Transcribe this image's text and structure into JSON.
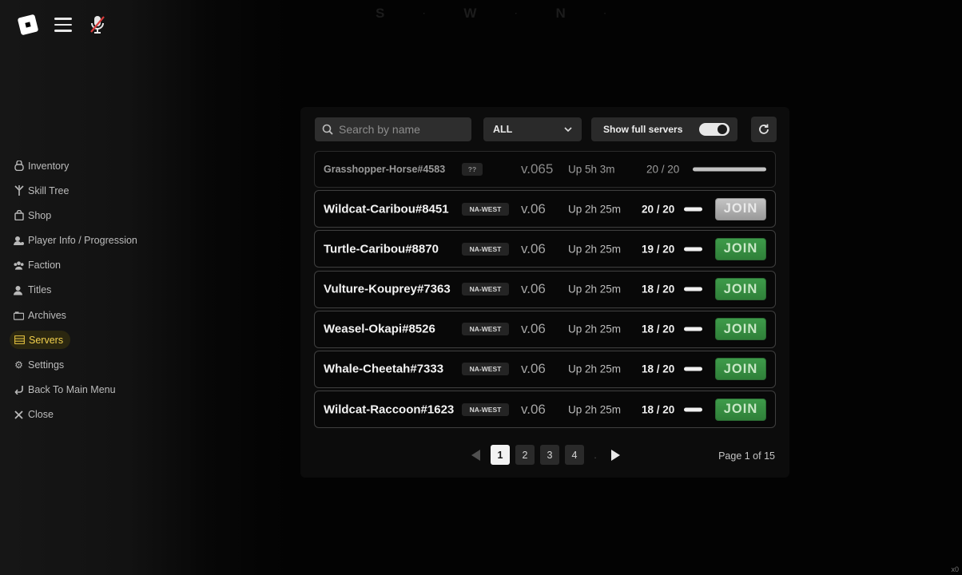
{
  "topbar": {
    "menu_icon": "hamburger-icon",
    "mic_icon": "mic-muted-icon",
    "logo": "roblox-logo"
  },
  "compass": [
    "S",
    "W",
    "N"
  ],
  "sidebar": {
    "items": [
      {
        "label": "Inventory",
        "icon": "bag-icon"
      },
      {
        "label": "Skill Tree",
        "icon": "skill-tree-icon"
      },
      {
        "label": "Shop",
        "icon": "shop-icon"
      },
      {
        "label": "Player Info / Progression",
        "icon": "player-icon"
      },
      {
        "label": "Faction",
        "icon": "group-icon"
      },
      {
        "label": "Titles",
        "icon": "user-icon"
      },
      {
        "label": "Archives",
        "icon": "archive-icon"
      },
      {
        "label": "Servers",
        "icon": "servers-icon",
        "active": true
      },
      {
        "label": "Settings",
        "icon": "gear-icon"
      },
      {
        "label": "Back To Main Menu",
        "icon": "back-arrow-icon"
      },
      {
        "label": "Close",
        "icon": "close-icon"
      }
    ]
  },
  "filters": {
    "search_placeholder": "Search by name",
    "region_select": "ALL",
    "show_full_label": "Show full servers",
    "show_full_on": true
  },
  "servers": [
    {
      "name": "Grasshopper-Horse#4583",
      "region": "??",
      "version": "v.065",
      "uptime": "Up 5h 3m",
      "players": "20 / 20",
      "fill": 1.0,
      "join": ""
    },
    {
      "name": "Wildcat-Caribou#8451",
      "region": "NA-WEST",
      "version": "v.06",
      "uptime": "Up 2h 25m",
      "players": "20 / 20",
      "fill": 1.0,
      "join": "JOIN",
      "full": true
    },
    {
      "name": "Turtle-Caribou#8870",
      "region": "NA-WEST",
      "version": "v.06",
      "uptime": "Up 2h 25m",
      "players": "19 / 20",
      "fill": 0.95,
      "join": "JOIN"
    },
    {
      "name": "Vulture-Kouprey#7363",
      "region": "NA-WEST",
      "version": "v.06",
      "uptime": "Up 2h 25m",
      "players": "18 / 20",
      "fill": 0.9,
      "join": "JOIN"
    },
    {
      "name": "Weasel-Okapi#8526",
      "region": "NA-WEST",
      "version": "v.06",
      "uptime": "Up 2h 25m",
      "players": "18 / 20",
      "fill": 0.9,
      "join": "JOIN"
    },
    {
      "name": "Whale-Cheetah#7333",
      "region": "NA-WEST",
      "version": "v.06",
      "uptime": "Up 2h 25m",
      "players": "18 / 20",
      "fill": 0.9,
      "join": "JOIN"
    },
    {
      "name": "Wildcat-Raccoon#1623",
      "region": "NA-WEST",
      "version": "v.06",
      "uptime": "Up 2h 25m",
      "players": "18 / 20",
      "fill": 0.9,
      "join": "JOIN"
    }
  ],
  "pagination": {
    "pages": [
      "1",
      "2",
      "3",
      "4"
    ],
    "current": "1",
    "info": "Page 1 of 15"
  },
  "corner_text": "x0",
  "colors": {
    "accent": "#f3d14d",
    "join": "#3e9b4a",
    "join_full": "#b0b0b0"
  }
}
